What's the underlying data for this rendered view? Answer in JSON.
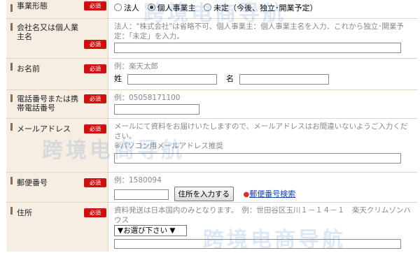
{
  "required_label": "必須",
  "business_type": {
    "label": "事業形態",
    "options": [
      "法人",
      "個人事業主",
      "未定（今後、独立･開業予定）"
    ],
    "selected_index": 0
  },
  "company": {
    "label": "会社名又は個人業主名",
    "hint": "法人：\"株式会社\"は省略不可、個人事業主：個人事業主名を入力、これから独立･開業予定：「未定」を入力。"
  },
  "name": {
    "label": "お名前",
    "hint": "例：楽天太郎",
    "last_label": "姓",
    "first_label": "名"
  },
  "phone": {
    "label": "電話番号または携帯電話番号",
    "hint": "例：05058171100"
  },
  "email": {
    "label": "メールアドレス",
    "hint1": "メールにて資料をお届けいたしますので、メールアドレスはお間違いないようご入力ください。",
    "hint2": "※パソコン用メールアドレス推奨"
  },
  "zip": {
    "label": "郵便番号",
    "hint": "例：1580094",
    "button": "住所を入力する",
    "link": "郵便番号検索"
  },
  "address": {
    "label": "住所",
    "hint": "資料発送は日本国内のみとなります。　例：世田谷区玉川１－１４－１　楽天クリムゾンハウス",
    "select": "▼お選び下さい ▼"
  },
  "watermark": "跨境电商导航"
}
